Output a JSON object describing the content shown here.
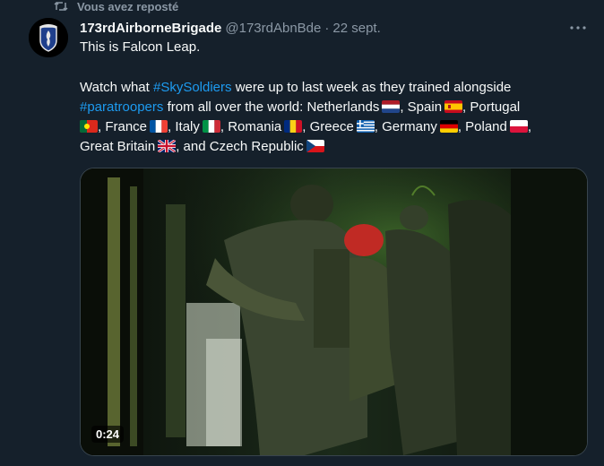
{
  "repost": {
    "label": "Vous avez reposté",
    "icon": "repost-icon"
  },
  "author": {
    "name": "173rdAirborneBrigade",
    "handle": "@173rdAbnBde",
    "separator": "·",
    "date": "22 sept.",
    "avatar_icon": "unit-insignia-avatar"
  },
  "more_icon": "more-options-icon",
  "tweet": {
    "line1": "This is Falcon Leap.",
    "line2_a": "Watch what ",
    "hashtag1": "#SkySoldiers",
    "line2_b": " were up to last week as they trained alongside",
    "hashtag2": "#paratroopers",
    "line2_c": " from all over the world: Netherlands",
    "c_spain": ", Spain",
    "c_portugal": ", Portugal",
    "c_france": ", France",
    "c_italy": ", Italy",
    "c_romania": ", Romania",
    "c_greece": ", Greece",
    "c_germany": ", Germany",
    "c_poland": ", Poland",
    "c_gb": ", Great Britain",
    "c_czech": ", and Czech Republic"
  },
  "media": {
    "duration": "0:24"
  },
  "colors": {
    "background": "#15202b",
    "text": "#f7f9f9",
    "muted": "#8b98a5",
    "link": "#1d9bf0"
  }
}
